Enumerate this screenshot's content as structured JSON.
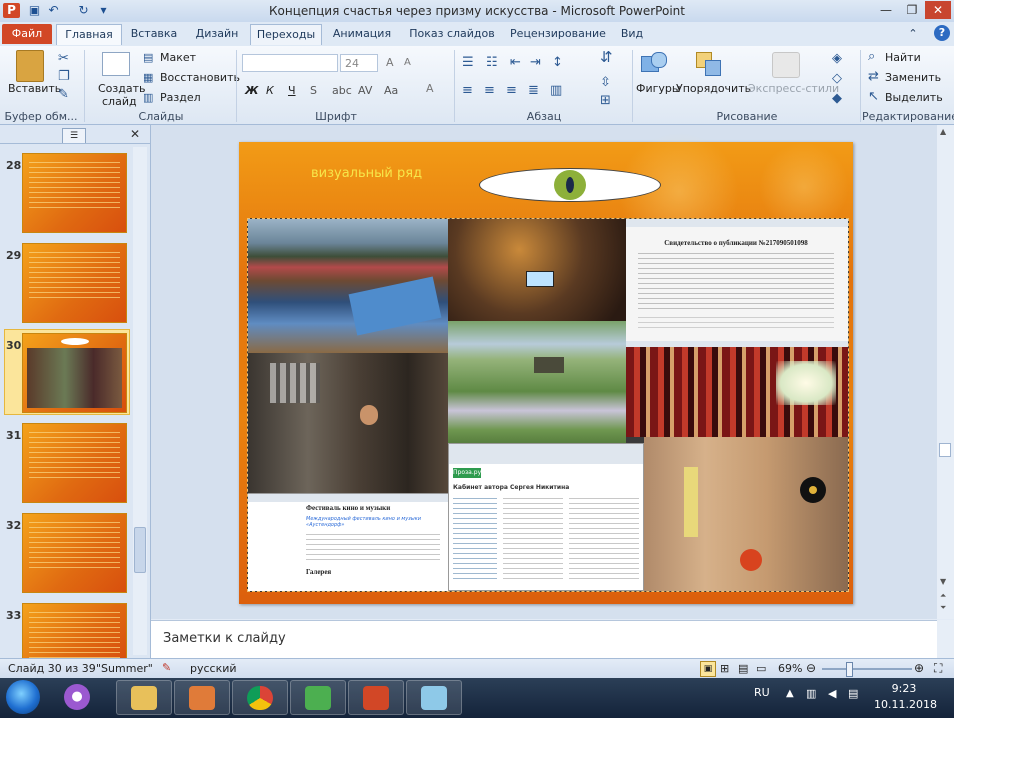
{
  "window": {
    "title": "Концепция счастья через призму искусства  -  Microsoft PowerPoint",
    "minimize": "—",
    "maximize": "❐",
    "close": "✕"
  },
  "tabs": [
    {
      "label": "Файл"
    },
    {
      "label": "Главная"
    },
    {
      "label": "Вставка"
    },
    {
      "label": "Дизайн"
    },
    {
      "label": "Переходы"
    },
    {
      "label": "Анимация"
    },
    {
      "label": "Показ слайдов"
    },
    {
      "label": "Рецензирование"
    },
    {
      "label": "Вид"
    }
  ],
  "ribbon": {
    "paste": "Вставить",
    "create_slide_1": "Создать",
    "create_slide_2": "слайд",
    "layout": "Макет",
    "restore": "Восстановить",
    "section": "Раздел",
    "font_size": "24",
    "bold": "Ж",
    "italic": "К",
    "underline": "Ч",
    "font_letter": "А",
    "shapes": "Фигуры",
    "arrange": "Упорядочить",
    "express_styles": "Экспресс-стили",
    "find": "Найти",
    "replace": "Заменить",
    "select": "Выделить",
    "groups": {
      "clipboard": "Буфер обм...",
      "slides": "Слайды",
      "font": "Шрифт",
      "paragraph": "Абзац",
      "drawing": "Рисование",
      "editing": "Редактирование"
    }
  },
  "thumbnails": [
    {
      "num": "28"
    },
    {
      "num": "29"
    },
    {
      "num": "30"
    },
    {
      "num": "31"
    },
    {
      "num": "32"
    },
    {
      "num": "33"
    }
  ],
  "slide": {
    "heading": "визуальный ряд",
    "photos": {
      "certificate_title": "Свидетельство о публикации №217090501098",
      "website_heading": "Фестиваль кино и музыки",
      "website_subheading": "Международный фестиваль кино и музыки «Аустендорф»",
      "website_gallery": "Галерея",
      "proza_brand": "Проза.ру",
      "proza_cabinet": "Кабинет автора Сергея Никитина"
    }
  },
  "notes_placeholder": "Заметки к слайду",
  "status": {
    "slide_info": "Слайд 30 из 39",
    "theme": "\"Summer\"",
    "language": "русский",
    "zoom": "69%"
  },
  "taskbar": {
    "lang": "RU",
    "time": "9:23",
    "date": "10.11.2018"
  },
  "colors": {
    "file_tab": "#d24726",
    "slide_orange": "#e9820f",
    "heading_yellow": "#f7e64a"
  }
}
